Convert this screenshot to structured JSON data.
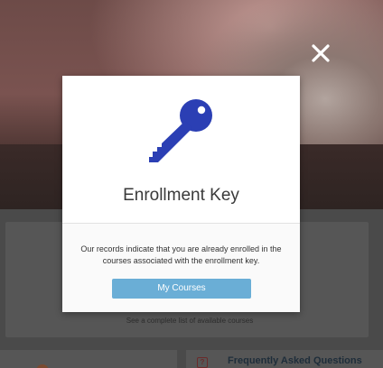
{
  "modal": {
    "title": "Enrollment Key",
    "message": "Our records indicate that you are already enrolled in the courses associated with the enrollment key.",
    "button_label": "My Courses",
    "icon": "key-icon",
    "close_icon": "close-icon"
  },
  "background": {
    "courses_link": "See a complete list of available courses",
    "faq_title": "Frequently Asked Questions",
    "faq_icon_glyph": "?"
  },
  "colors": {
    "key_blue": "#2b3fb4",
    "button_blue": "#6aaed6"
  }
}
